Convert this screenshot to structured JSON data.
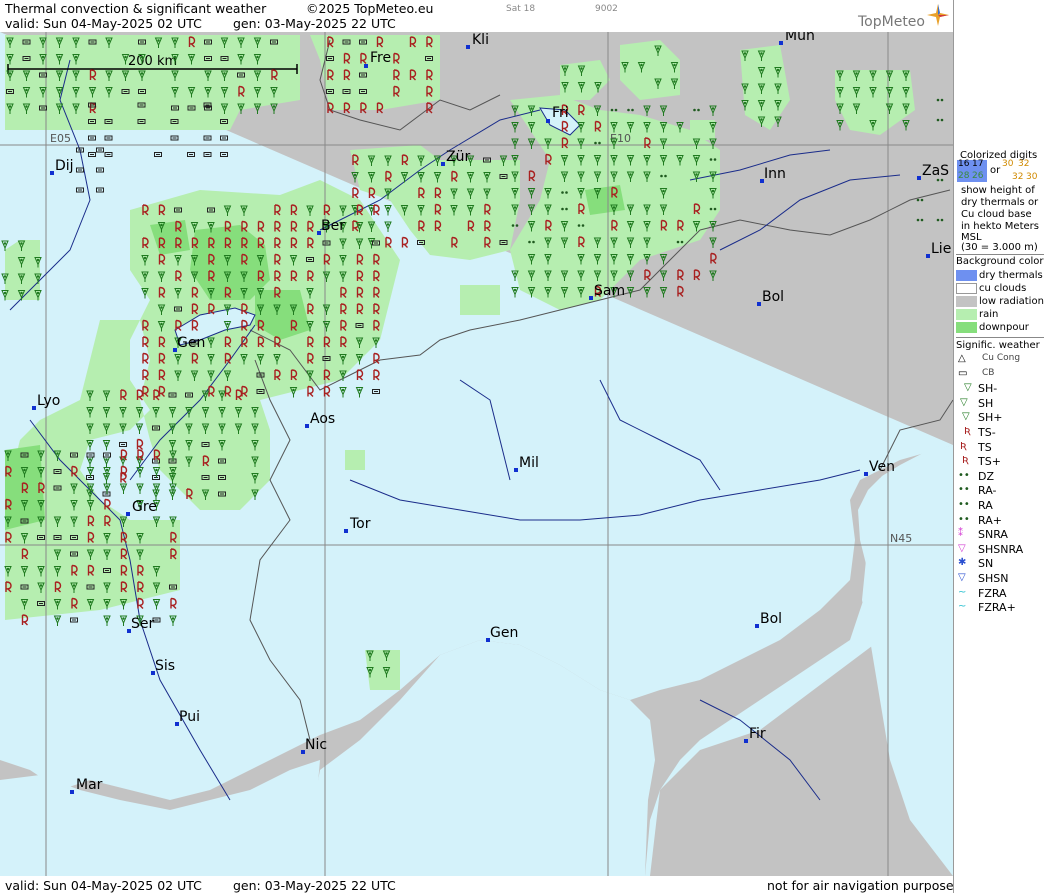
{
  "header": {
    "title": "Thermal convection & significant weather",
    "copyright": "©2025 TopMeteo.eu",
    "day_code": "Sat 18",
    "code": "9002",
    "valid": "valid:  Sun  04-May-2025  02 UTC",
    "gen": "gen: 03-May-2025 22 UTC",
    "logo": "TopMeteo"
  },
  "map": {
    "scale_label": "200 km",
    "grid_labels": [
      "E05",
      "E10",
      "N45"
    ],
    "cities": [
      "Kli",
      "Mun",
      "Fre",
      "Fri",
      "Dij",
      "Zür",
      "Inn",
      "ZaS",
      "Ber",
      "Lie",
      "Sam",
      "Bol",
      "Gen",
      "Lyo",
      "Aos",
      "Mil",
      "Ven",
      "Gre",
      "Tor",
      "Ser",
      "Gen",
      "Bol",
      "Sis",
      "Pui",
      "Nic",
      "Fir",
      "Mar"
    ]
  },
  "footer": {
    "valid": "valid:  Sun  04-May-2025  02 UTC",
    "gen": "gen: 03-May-2025 22 UTC",
    "note": "not for air navigation purposes"
  },
  "legend": {
    "colorized_title": [
      "Colorized digits"
    ],
    "digits_a": [
      "16",
      "17"
    ],
    "digits_b": [
      "30",
      "32"
    ],
    "digits_c": [
      "28",
      "26"
    ],
    "digits_d": [
      "32",
      "30"
    ],
    "or": "or",
    "desc": [
      "show height of",
      "dry thermals or",
      "Cu cloud base",
      "in hekto Meters",
      "MSL",
      "(30 = 3.000 m)"
    ],
    "bg_title": "Background color",
    "bg_items": [
      {
        "label": "dry thermals",
        "color": "#6e90f0"
      },
      {
        "label": "cu clouds",
        "color": "#ffffff"
      },
      {
        "label": "low radiation",
        "color": "#c3c3c3"
      },
      {
        "label": "rain",
        "color": "#b6eeb0"
      },
      {
        "label": "downpour",
        "color": "#86de7c"
      }
    ],
    "wx_title": "Signific. weather",
    "wx_items": [
      "Cu Cong",
      "CB",
      "SH-",
      "SH",
      "SH+",
      "TS-",
      "TS",
      "TS+",
      "DZ",
      "RA-",
      "RA",
      "RA+",
      "SNRA",
      "SHSNRA",
      "SN",
      "SHSN",
      "FZRA",
      "FZRA+"
    ],
    "colors": {
      "land": "#c3c3c3",
      "sea": "#d4f2fa",
      "rain": "#b6eeb0",
      "downpour": "#86de7c",
      "ts": "#a82020",
      "sh": "#1f7a1f"
    }
  }
}
